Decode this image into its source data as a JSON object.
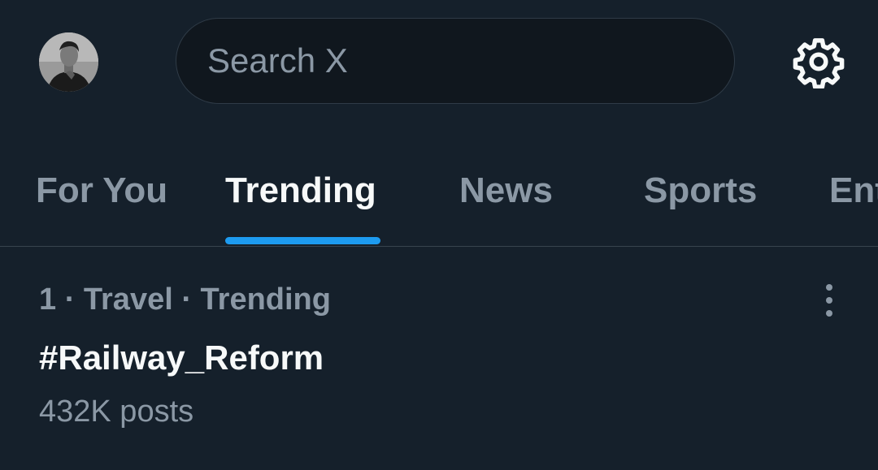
{
  "header": {
    "search_placeholder": "Search X",
    "avatar_icon": "user-avatar",
    "settings_icon": "gear-icon"
  },
  "tabs": [
    {
      "label": "For You",
      "active": false
    },
    {
      "label": "Trending",
      "active": true
    },
    {
      "label": "News",
      "active": false
    },
    {
      "label": "Sports",
      "active": false
    },
    {
      "label": "Entertainment",
      "active": false
    }
  ],
  "trends": [
    {
      "meta": "1 · Travel · Trending",
      "title": "#Railway_Reform",
      "posts": "432K posts",
      "more_icon": "more-vertical-icon"
    }
  ],
  "colors": {
    "background": "#15202b",
    "accent": "#1d9bf0",
    "secondary_text": "#8b98a5",
    "primary_text": "#f7f9f9"
  }
}
